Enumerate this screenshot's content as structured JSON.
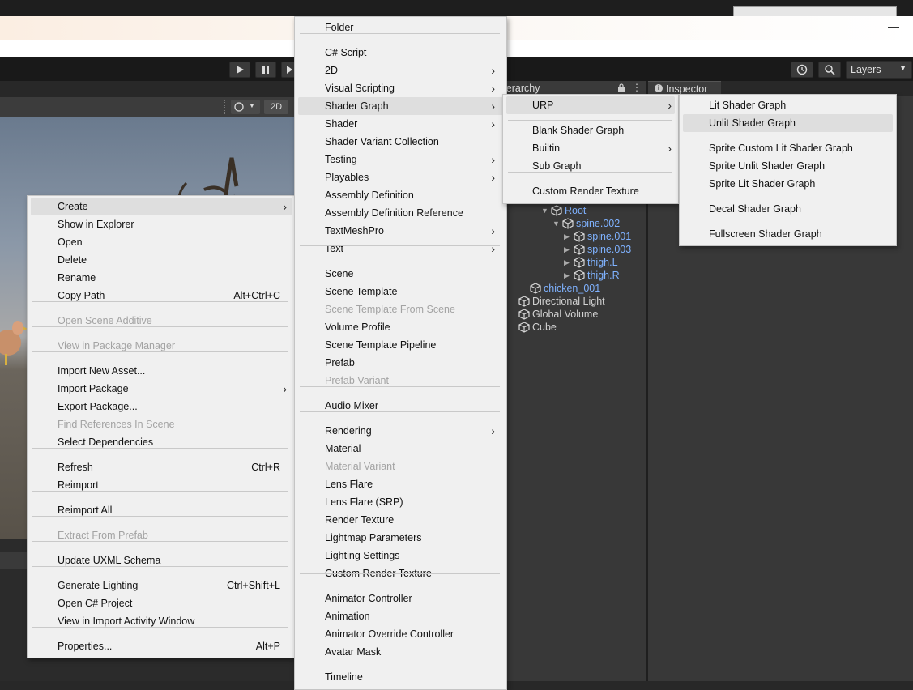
{
  "toolbar": {
    "mode_2d": "2D",
    "layers_label": "Layers"
  },
  "panels": {
    "hierarchy_tab": "ierarchy",
    "inspector_tab": "Inspector"
  },
  "hierarchy": {
    "rows": [
      {
        "label": "Root",
        "color": "blue"
      },
      {
        "label": "spine.002",
        "color": "blue"
      },
      {
        "label": "spine.001",
        "color": "blue"
      },
      {
        "label": "spine.003",
        "color": "blue"
      },
      {
        "label": "thigh.L",
        "color": "blue"
      },
      {
        "label": "thigh.R",
        "color": "blue"
      },
      {
        "label": "chicken_001",
        "color": "blue"
      },
      {
        "label": "Directional Light",
        "color": "white"
      },
      {
        "label": "Global Volume",
        "color": "white"
      },
      {
        "label": "Cube",
        "color": "white"
      }
    ]
  },
  "context_menu": {
    "items": [
      {
        "label": "Create",
        "submenu": true,
        "highlighted": true
      },
      {
        "label": "Show in Explorer"
      },
      {
        "label": "Open"
      },
      {
        "label": "Delete"
      },
      {
        "label": "Rename"
      },
      {
        "label": "Copy Path",
        "shortcut": "Alt+Ctrl+C"
      },
      {
        "label": "Open Scene Additive",
        "disabled": true
      },
      {
        "label": "View in Package Manager",
        "disabled": true
      },
      {
        "label": "Import New Asset..."
      },
      {
        "label": "Import Package",
        "submenu": true
      },
      {
        "label": "Export Package..."
      },
      {
        "label": "Find References In Scene",
        "disabled": true
      },
      {
        "label": "Select Dependencies"
      },
      {
        "label": "Refresh",
        "shortcut": "Ctrl+R"
      },
      {
        "label": "Reimport"
      },
      {
        "label": "Reimport All"
      },
      {
        "label": "Extract From Prefab",
        "disabled": true
      },
      {
        "label": "Update UXML Schema"
      },
      {
        "label": "Generate Lighting",
        "shortcut": "Ctrl+Shift+L"
      },
      {
        "label": "Open C# Project"
      },
      {
        "label": "View in Import Activity Window"
      },
      {
        "label": "Properties...",
        "shortcut": "Alt+P"
      }
    ]
  },
  "create_menu": {
    "items": [
      {
        "label": "Folder"
      },
      {
        "label": "C# Script"
      },
      {
        "label": "2D",
        "submenu": true
      },
      {
        "label": "Visual Scripting",
        "submenu": true
      },
      {
        "label": "Shader Graph",
        "submenu": true,
        "highlighted": true
      },
      {
        "label": "Shader",
        "submenu": true
      },
      {
        "label": "Shader Variant Collection"
      },
      {
        "label": "Testing",
        "submenu": true
      },
      {
        "label": "Playables",
        "submenu": true
      },
      {
        "label": "Assembly Definition"
      },
      {
        "label": "Assembly Definition Reference"
      },
      {
        "label": "TextMeshPro",
        "submenu": true
      },
      {
        "label": "Text",
        "submenu": true
      },
      {
        "label": "Scene"
      },
      {
        "label": "Scene Template"
      },
      {
        "label": "Scene Template From Scene",
        "disabled": true
      },
      {
        "label": "Volume Profile"
      },
      {
        "label": "Scene Template Pipeline"
      },
      {
        "label": "Prefab"
      },
      {
        "label": "Prefab Variant",
        "disabled": true
      },
      {
        "label": "Audio Mixer"
      },
      {
        "label": "Rendering",
        "submenu": true
      },
      {
        "label": "Material"
      },
      {
        "label": "Material Variant",
        "disabled": true
      },
      {
        "label": "Lens Flare"
      },
      {
        "label": "Lens Flare (SRP)"
      },
      {
        "label": "Render Texture"
      },
      {
        "label": "Lightmap Parameters"
      },
      {
        "label": "Lighting Settings"
      },
      {
        "label": "Custom Render Texture"
      },
      {
        "label": "Animator Controller"
      },
      {
        "label": "Animation"
      },
      {
        "label": "Animator Override Controller"
      },
      {
        "label": "Avatar Mask"
      },
      {
        "label": "Timeline"
      }
    ]
  },
  "shader_graph_menu": {
    "items": [
      {
        "label": "URP",
        "submenu": true,
        "highlighted": true
      },
      {
        "label": "Blank Shader Graph"
      },
      {
        "label": "Builtin",
        "submenu": true
      },
      {
        "label": "Sub Graph"
      },
      {
        "label": "Custom Render Texture"
      }
    ]
  },
  "urp_menu": {
    "items": [
      {
        "label": "Lit Shader Graph"
      },
      {
        "label": "Unlit Shader Graph",
        "highlighted": true
      },
      {
        "label": "Sprite Custom Lit Shader Graph"
      },
      {
        "label": "Sprite Unlit Shader Graph"
      },
      {
        "label": "Sprite Lit Shader Graph"
      },
      {
        "label": "Decal Shader Graph"
      },
      {
        "label": "Fullscreen Shader Graph"
      }
    ]
  }
}
